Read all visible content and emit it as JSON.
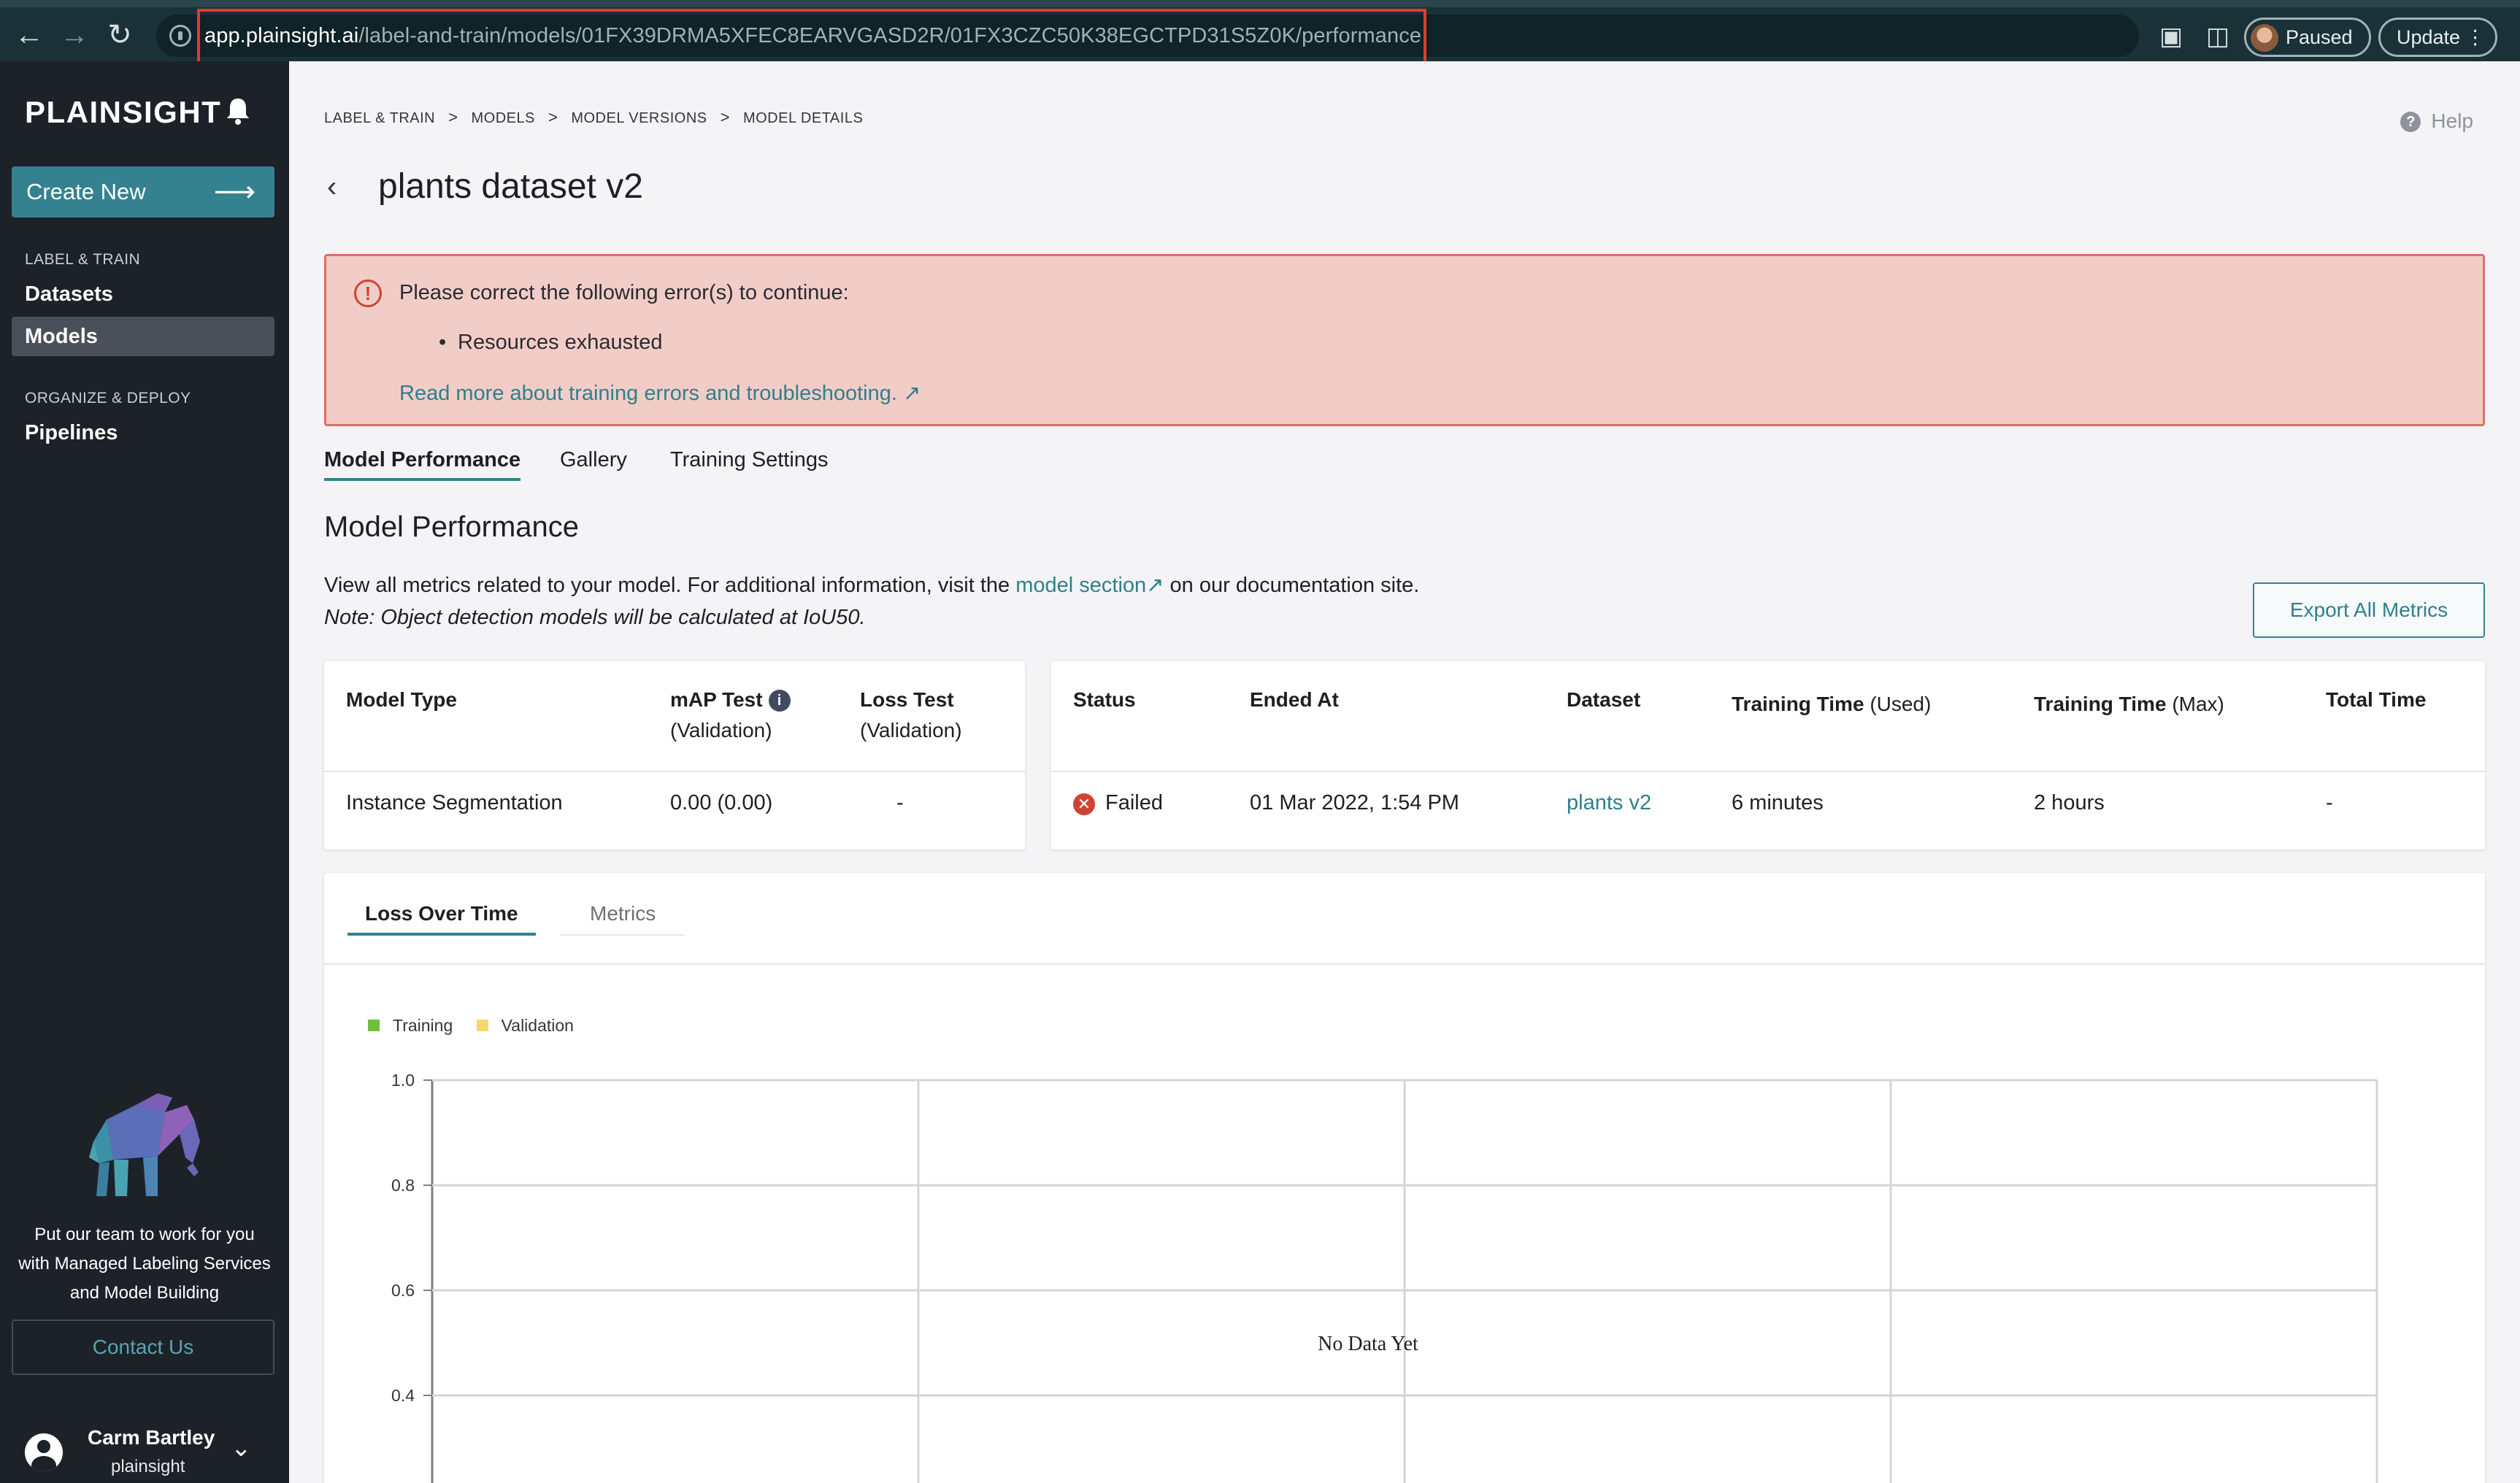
{
  "browser": {
    "url_host": "app.plainsight.ai",
    "url_path": "/label-and-train/models/01FX39DRMA5XFEC8EARVGASD2R/01FX3CZC50K38EGCTPD31S5Z0K/performance",
    "profile_label": "Paused",
    "update_label": "Update"
  },
  "sidebar": {
    "brand": "PLAINSIGHT",
    "create_label": "Create New",
    "sections": [
      {
        "title": "LABEL & TRAIN",
        "items": [
          {
            "label": "Datasets"
          },
          {
            "label": "Models"
          }
        ]
      },
      {
        "title": "ORGANIZE & DEPLOY",
        "items": [
          {
            "label": "Pipelines"
          }
        ]
      }
    ],
    "promo_lines": [
      "Put our team to work for you",
      "with Managed Labeling Services",
      "and Model Building"
    ],
    "contact_label": "Contact Us",
    "user_name": "Carm Bartley",
    "user_org": "plainsight"
  },
  "header": {
    "breadcrumbs": [
      "LABEL & TRAIN",
      "MODELS",
      "MODEL VERSIONS",
      "MODEL DETAILS"
    ],
    "help_label": "Help",
    "title": "plants dataset v2"
  },
  "error": {
    "title": "Please correct the following error(s) to continue:",
    "items": [
      "Resources exhausted"
    ],
    "link_text": "Read more about training errors and troubleshooting."
  },
  "tabs": [
    "Model Performance",
    "Gallery",
    "Training Settings"
  ],
  "performance": {
    "title": "Model Performance",
    "desc_before": "View all metrics related to your model. For additional information, visit the",
    "desc_link": "model section",
    "desc_after": "on our documentation site.",
    "note": "Note: Object detection models will be calculated at IoU50.",
    "export_label": "Export All Metrics"
  },
  "model_table": {
    "headers": [
      {
        "main": "Model Type",
        "sub": ""
      },
      {
        "main": "mAP Test",
        "sub": "(Validation)"
      },
      {
        "main": "Loss Test",
        "sub": "(Validation)"
      }
    ],
    "row": [
      "Instance Segmentation",
      "0.00 (0.00)",
      "-"
    ]
  },
  "status_table": {
    "headers": [
      {
        "main": "Status",
        "sub": ""
      },
      {
        "main": "Ended At",
        "sub": ""
      },
      {
        "main": "Dataset",
        "sub": ""
      },
      {
        "main": "Training Time",
        "sub": "(Used)"
      },
      {
        "main": "Training Time",
        "sub": "(Max)"
      },
      {
        "main": "Total Time",
        "sub": ""
      }
    ],
    "row": [
      "Failed",
      "01 Mar 2022, 1:54 PM",
      "plants v2",
      "6 minutes",
      "2 hours",
      "-"
    ]
  },
  "chart_tabs": [
    "Loss Over Time",
    "Metrics"
  ],
  "colors": {
    "accent": "#34828f",
    "error": "#d04232",
    "training": "#6fbf3a",
    "validation": "#f5d76e"
  },
  "chart_data": {
    "type": "line",
    "legend": [
      "Training",
      "Validation"
    ],
    "y_ticks": [
      "1.0",
      "0.8",
      "0.6",
      "0.4"
    ],
    "ylim": [
      0.4,
      1.0
    ],
    "series": [],
    "empty_message": "No Data Yet",
    "grid": true,
    "legend_placement": "top-left"
  }
}
